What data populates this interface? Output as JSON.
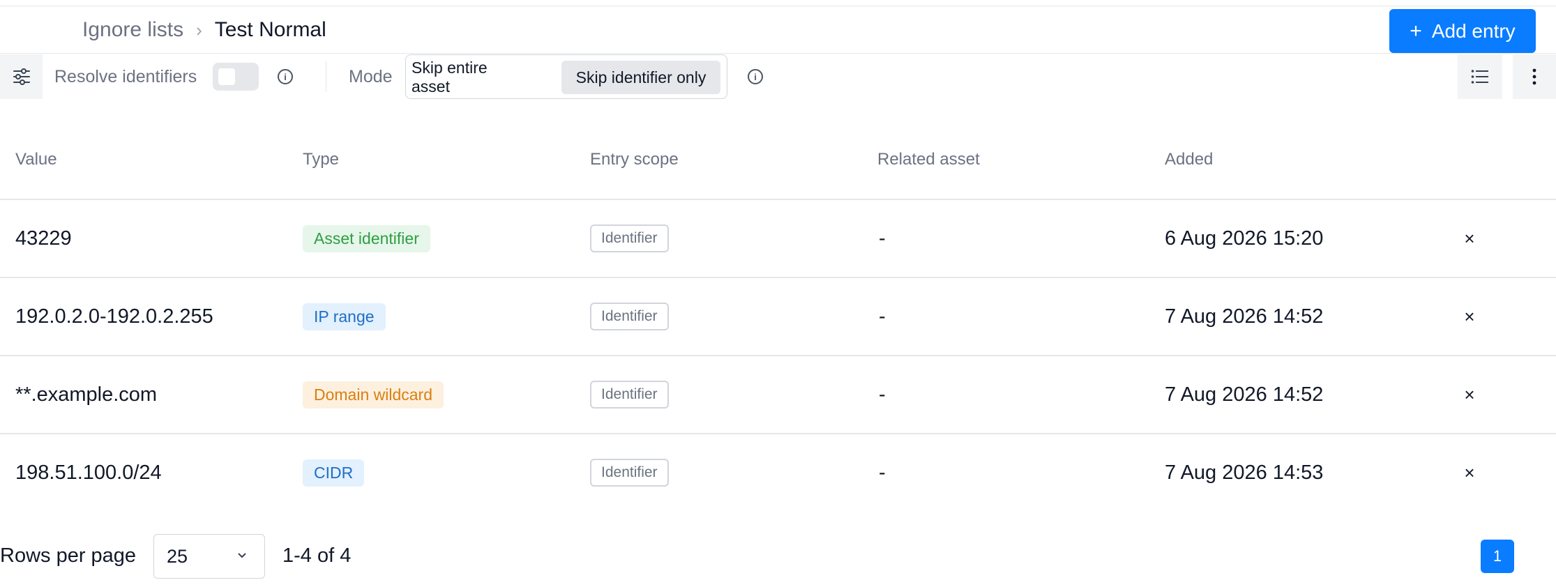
{
  "breadcrumb": {
    "parent": "Ignore lists",
    "separator": "›",
    "current": "Test Normal"
  },
  "header": {
    "add_button_icon": "+",
    "add_button_label": "Add entry"
  },
  "toolbar": {
    "resolve_label": "Resolve identifiers",
    "resolve_enabled": false,
    "info_glyph": "i",
    "mode_label": "Mode",
    "mode_options": [
      "Skip entire asset",
      "Skip identifier only"
    ],
    "mode_selected": "Skip identifier only"
  },
  "table": {
    "columns": [
      "Value",
      "Type",
      "Entry scope",
      "Related asset",
      "Added"
    ],
    "rows": [
      {
        "value": "43229",
        "type": "Asset identifier",
        "scope": "Identifier",
        "related": "-",
        "added": "6 Aug 2026 15:20",
        "remove": "×"
      },
      {
        "value": "192.0.2.0-192.0.2.255",
        "type": "IP range",
        "scope": "Identifier",
        "related": "-",
        "added": "7 Aug 2026 14:52",
        "remove": "×"
      },
      {
        "value": "**.example.com",
        "type": "Domain wildcard",
        "scope": "Identifier",
        "related": "-",
        "added": "7 Aug 2026 14:52",
        "remove": "×"
      },
      {
        "value": "198.51.100.0/24",
        "type": "CIDR",
        "scope": "Identifier",
        "related": "-",
        "added": "7 Aug 2026 14:53",
        "remove": "×"
      }
    ]
  },
  "footer": {
    "rows_per_page_label": "Rows per page",
    "rows_per_page_value": "25",
    "range": "1-4 of 4",
    "current_page": "1"
  },
  "colors": {
    "accent": "#0a7cff",
    "badge_green": "#2f9e44",
    "badge_blue": "#1f6fc5",
    "badge_orange": "#d97f10"
  },
  "icons": {
    "filter": "sliders-icon",
    "info": "info-icon",
    "list": "list-icon",
    "more": "more-vertical-icon",
    "chevron": "chevron-down-icon",
    "close": "close-icon",
    "plus": "plus-icon"
  }
}
